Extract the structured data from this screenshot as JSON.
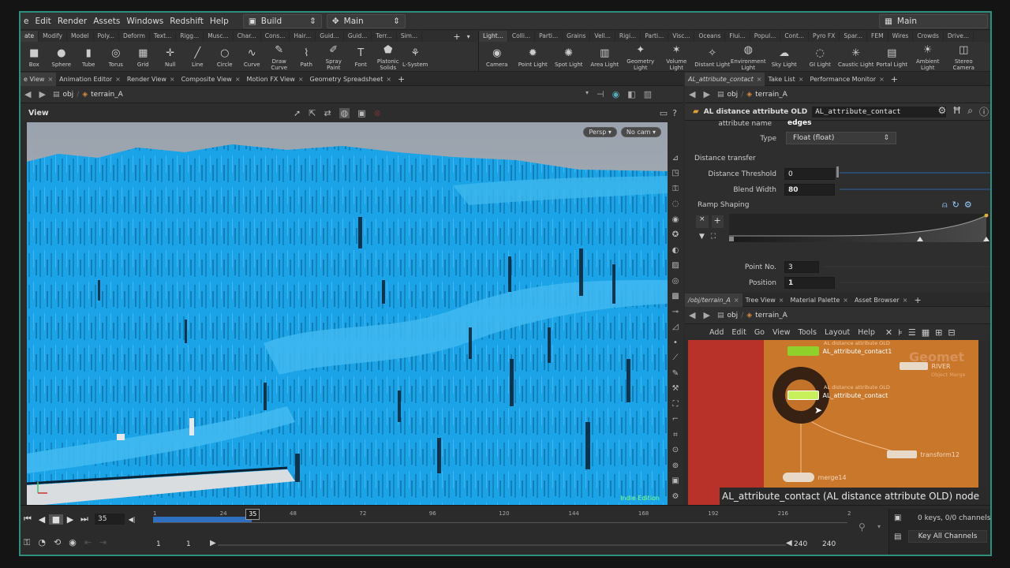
{
  "menubar": {
    "items": [
      "e",
      "Edit",
      "Render",
      "Assets",
      "Windows",
      "Redshift",
      "Help"
    ],
    "desktop": "Build",
    "context": "Main",
    "right_desktop": "Main"
  },
  "shelf": {
    "left_tabs": [
      "ate",
      "Modify",
      "Model",
      "Poly...",
      "Deform",
      "Text...",
      "Rigg...",
      "Musc...",
      "Char...",
      "Cons...",
      "Hair...",
      "Guid...",
      "Guid...",
      "Terr...",
      "Sim..."
    ],
    "right_tabs": [
      "Light...",
      "Colli...",
      "Parti...",
      "Grains",
      "Vell...",
      "Rigi...",
      "Parti...",
      "Visc...",
      "Oceans",
      "Flui...",
      "Popul...",
      "Cont...",
      "Pyro FX",
      "Spar...",
      "FEM",
      "Wires",
      "Crowds",
      "Drive..."
    ],
    "left_tools": [
      {
        "label": "Box",
        "icon": "box-icon",
        "glyph": "■"
      },
      {
        "label": "Sphere",
        "icon": "sphere-icon",
        "glyph": "●"
      },
      {
        "label": "Tube",
        "icon": "tube-icon",
        "glyph": "▮"
      },
      {
        "label": "Torus",
        "icon": "torus-icon",
        "glyph": "◎"
      },
      {
        "label": "Grid",
        "icon": "grid-icon",
        "glyph": "▦"
      },
      {
        "label": "Null",
        "icon": "null-icon",
        "glyph": "✛"
      },
      {
        "label": "Line",
        "icon": "line-icon",
        "glyph": "╱"
      },
      {
        "label": "Circle",
        "icon": "circle-icon",
        "glyph": "○"
      },
      {
        "label": "Curve",
        "icon": "curve-icon",
        "glyph": "∿"
      },
      {
        "label": "Draw Curve",
        "icon": "draw-curve-icon",
        "glyph": "✎"
      },
      {
        "label": "Path",
        "icon": "path-icon",
        "glyph": "⌇"
      },
      {
        "label": "Spray Paint",
        "icon": "spray-paint-icon",
        "glyph": "✐"
      },
      {
        "label": "Font",
        "icon": "font-icon",
        "glyph": "T"
      },
      {
        "label": "Platonic Solids",
        "icon": "platonic-icon",
        "glyph": "⬟"
      },
      {
        "label": "L-System",
        "icon": "lsystem-icon",
        "glyph": "⚘"
      }
    ],
    "right_tools": [
      {
        "label": "Camera",
        "icon": "camera-icon",
        "glyph": "◉"
      },
      {
        "label": "Point Light",
        "icon": "point-light-icon",
        "glyph": "✹"
      },
      {
        "label": "Spot Light",
        "icon": "spot-light-icon",
        "glyph": "✺"
      },
      {
        "label": "Area Light",
        "icon": "area-light-icon",
        "glyph": "▥"
      },
      {
        "label": "Geometry Light",
        "icon": "geometry-light-icon",
        "glyph": "✦"
      },
      {
        "label": "Volume Light",
        "icon": "volume-light-icon",
        "glyph": "✶"
      },
      {
        "label": "Distant Light",
        "icon": "distant-light-icon",
        "glyph": "✧"
      },
      {
        "label": "Environment Light",
        "icon": "environment-light-icon",
        "glyph": "◍"
      },
      {
        "label": "Sky Light",
        "icon": "sky-light-icon",
        "glyph": "☁"
      },
      {
        "label": "GI Light",
        "icon": "gi-light-icon",
        "glyph": "◌"
      },
      {
        "label": "Caustic Light",
        "icon": "caustic-light-icon",
        "glyph": "✳"
      },
      {
        "label": "Portal Light",
        "icon": "portal-light-icon",
        "glyph": "▤"
      },
      {
        "label": "Ambient Light",
        "icon": "ambient-light-icon",
        "glyph": "☀"
      },
      {
        "label": "Stereo Camera",
        "icon": "stereo-camera-icon",
        "glyph": "◫"
      }
    ]
  },
  "left_pane": {
    "tabs": [
      "e View",
      "Animation Editor",
      "Render View",
      "Composite View",
      "Motion FX View",
      "Geometry Spreadsheet"
    ],
    "path_root": "obj",
    "path_node": "terrain_A",
    "view_title": "View",
    "persp": "Persp",
    "cam": "No cam",
    "watermark": "Indie Edition"
  },
  "params": {
    "tabs": [
      "AL_attribute_contact",
      "Take List",
      "Performance Monitor"
    ],
    "path_root": "obj",
    "path_node": "terrain_A",
    "node_type": "AL distance attribute OLD",
    "node_name": "AL_attribute_contact",
    "attr_name_label": "attribute name",
    "attr_name_value": "edges",
    "type_label": "Type",
    "type_value": "Float (float)",
    "section_distance": "Distance transfer",
    "threshold_label": "Distance Threshold",
    "threshold_value": "0",
    "blend_label": "Blend Width",
    "blend_value": "80",
    "section_ramp": "Ramp Shaping",
    "pointno_label": "Point No.",
    "pointno_value": "3",
    "position_label": "Position",
    "position_value": "1"
  },
  "network": {
    "tabs": [
      "/obj/terrain_A",
      "Tree View",
      "Material Palette",
      "Asset Browser"
    ],
    "path_root": "obj",
    "path_node": "terrain_A",
    "menu": [
      "Add",
      "Edit",
      "Go",
      "View",
      "Tools",
      "Layout",
      "Help"
    ],
    "bg_label": "Geomet",
    "nodes": {
      "top_type": "AL distance attribute OLD",
      "top_name": "AL_attribute_contact1",
      "sel_type": "AL distance attribute OLD",
      "sel_name": "AL_attribute_contact",
      "river": "RIVER",
      "river_sub": "Object Merge",
      "transform": "transform12",
      "merge": "merge14"
    },
    "tooltip": "AL_attribute_contact (AL distance attribute OLD) node"
  },
  "timeline": {
    "frame": "35",
    "current_marker": "35",
    "ticks": [
      "1",
      "24",
      "48",
      "72",
      "96",
      "120",
      "144",
      "168",
      "192",
      "216",
      "2"
    ],
    "range_start": "1",
    "range_start2": "1",
    "range_end": "240",
    "range_end2": "240",
    "keys_status": "0 keys, 0/0 channels",
    "key_all": "Key All Channels",
    "progress": 0.142
  },
  "colors": {
    "accent": "#2f8f7f",
    "terrain": "#1aa3e6",
    "network_bg": "#c9772b",
    "network_red": "#b8322a",
    "node_green": "#8fd12a"
  }
}
